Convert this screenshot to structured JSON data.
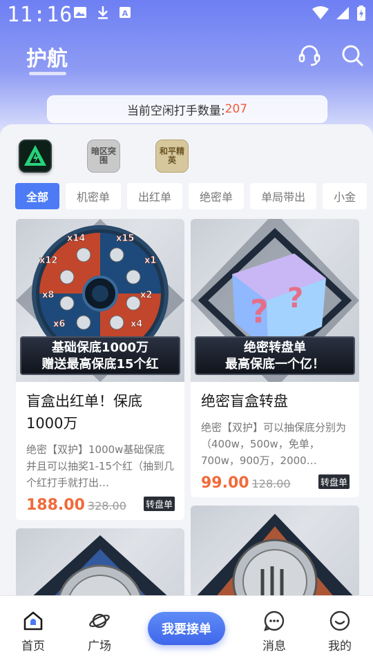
{
  "status_bar": {
    "time": "11:16"
  },
  "header": {
    "title": "护航"
  },
  "idle_banner": {
    "label": "当前空闲打手数量:",
    "count": "207"
  },
  "game_icons": [
    {
      "name": "apex",
      "text": ""
    },
    {
      "name": "dark-zone",
      "text": "暗区突围"
    },
    {
      "name": "peace-elite",
      "text": "和平精英"
    }
  ],
  "categories": [
    "全部",
    "机密单",
    "出红单",
    "绝密单",
    "单局带出",
    "小金"
  ],
  "cards": [
    {
      "banner_line1": "基础保底1000万",
      "banner_line2": "赠送最高保底15个红",
      "title": "盲盒出红单！保底1000万",
      "desc": "绝密【双护】1000w基础保底并且可以抽奖1-15个红（抽到几个红打手就打出…",
      "price": "188.00",
      "original_price": "328.00",
      "tag": "转盘单"
    },
    {
      "banner_line1": "绝密转盘单",
      "banner_line2": "最高保底一个亿！",
      "title": "绝密盲盒转盘",
      "desc": "绝密【双护】可以抽保底分别为（400w，500w，免单，700w，900万，2000…",
      "price": "99.00",
      "original_price": "128.00",
      "tag": "转盘单"
    }
  ],
  "wheel_labels": [
    "x14",
    "x15",
    "x12",
    "x1",
    "x8",
    "x2",
    "x6",
    "x4"
  ],
  "tabbar": {
    "home": "首页",
    "plaza": "广场",
    "accept": "我要接单",
    "messages": "消息",
    "mine": "我的"
  },
  "colors": {
    "accent": "#4c7bf5",
    "price": "#f06a3a",
    "count": "#f05a3a"
  }
}
